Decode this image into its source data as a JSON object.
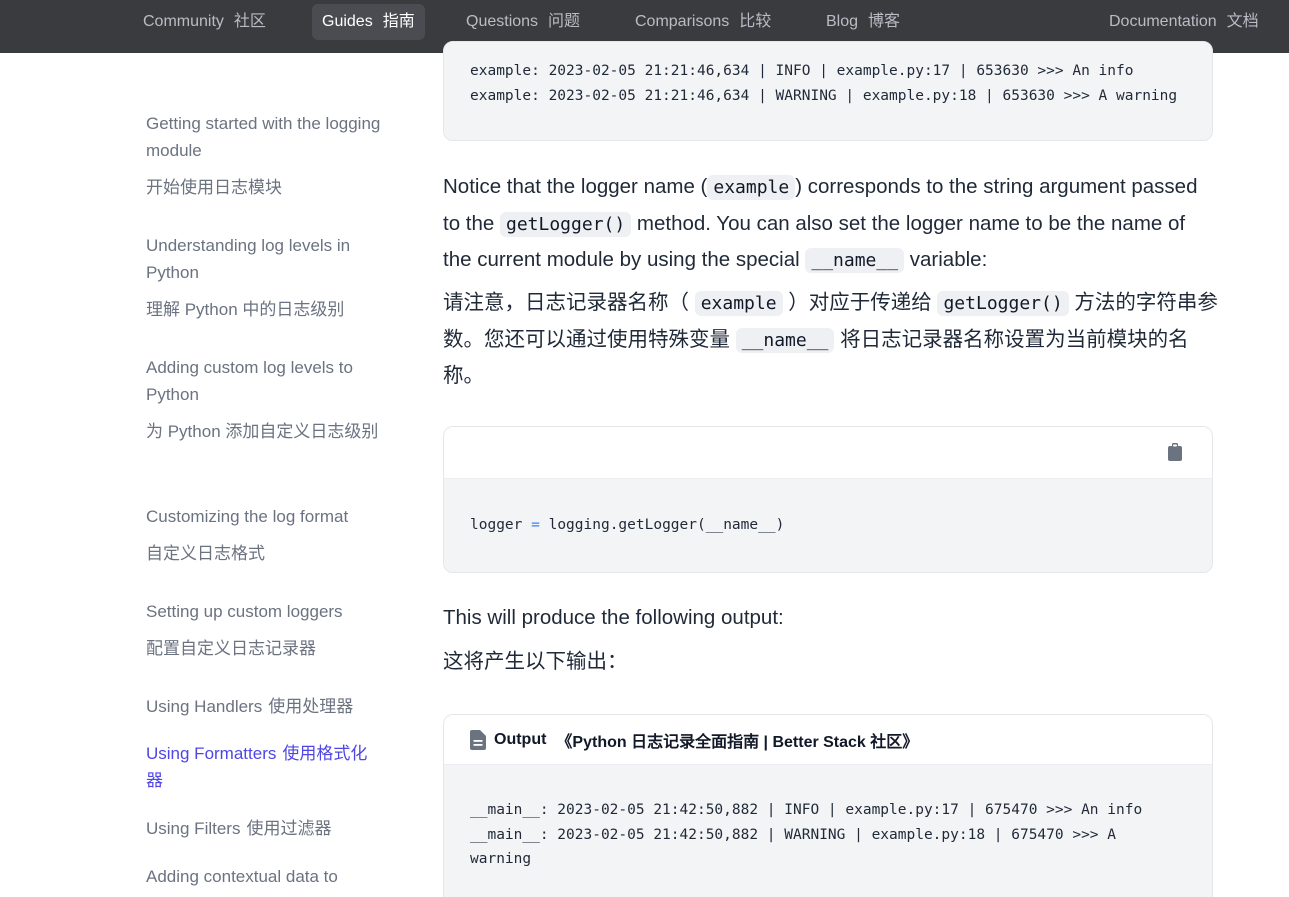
{
  "nav": {
    "items": [
      {
        "en": "Community",
        "zh": "社区"
      },
      {
        "en": "Guides",
        "zh": "指南"
      },
      {
        "en": "Questions",
        "zh": "问题"
      },
      {
        "en": "Comparisons",
        "zh": "比较"
      },
      {
        "en": "Blog",
        "zh": "博客"
      },
      {
        "en": "Documentation",
        "zh": "文档"
      }
    ],
    "active_index": 1
  },
  "sidebar": {
    "items": [
      {
        "en": "Getting started with the logging module",
        "zh": "开始使用日志模块"
      },
      {
        "en": "Understanding log levels in Python",
        "zh": "理解 Python 中的日志级别"
      },
      {
        "en": "Adding custom log levels to Python",
        "zh": "为 Python 添加自定义日志级别"
      },
      {
        "en": "Customizing the log format",
        "zh": "自定义日志格式"
      },
      {
        "en": "Setting up custom loggers",
        "zh": "配置自定义日志记录器"
      },
      {
        "en": "Using Handlers",
        "zh": "使用处理器"
      },
      {
        "en": "Using Formatters",
        "zh": "使用格式化器"
      },
      {
        "en": "Using Filters",
        "zh": "使用过滤器"
      },
      {
        "en": "Adding contextual data to",
        "zh": ""
      }
    ]
  },
  "main": {
    "top_output_lines": [
      "example: 2023-02-05 21:21:46,634 | INFO | example.py:17 | 653630 >>> An info",
      "example: 2023-02-05 21:21:46,634 | WARNING | example.py:18 | 653630 >>> A warning"
    ],
    "para1": {
      "t1": "Notice that the logger name (",
      "c1": "example",
      "t2": ") corresponds to the string argument passed to the ",
      "c2": "getLogger()",
      "t3": " method. You can also set the logger name to be the name of the current module by using the special ",
      "c3": "__name__",
      "t4": " variable:"
    },
    "para1_zh": {
      "t1": "请注意，日志记录器名称（ ",
      "c1": "example",
      "t2": " ）对应于传递给 ",
      "c2": "getLogger()",
      "t3": " 方法的字符串参数。您还可以通过使用特殊变量 ",
      "c3": "__name__",
      "t4": " 将日志记录器名称设置为当前模块的名称。"
    },
    "code": {
      "var": "logger",
      "op": "=",
      "rest": "logging.getLogger(__name__)"
    },
    "para2": "This will produce the following output:",
    "para2_zh": "这将产生以下输出：",
    "output_box": {
      "label": "Output",
      "title": "《Python 日志记录全面指南 | Better Stack 社区》",
      "lines": [
        "__main__: 2023-02-05 21:42:50,882 | INFO | example.py:17 | 675470 >>> An info",
        "__main__: 2023-02-05 21:42:50,882 | WARNING | example.py:18 | 675470 >>> A",
        "warning"
      ]
    }
  },
  "colors": {
    "nav_bg": "#3a3b3f",
    "accent": "#4f46e5",
    "code_bg": "#f3f4f6"
  },
  "icons": {
    "copy": "clipboard-icon",
    "output": "document-icon"
  }
}
